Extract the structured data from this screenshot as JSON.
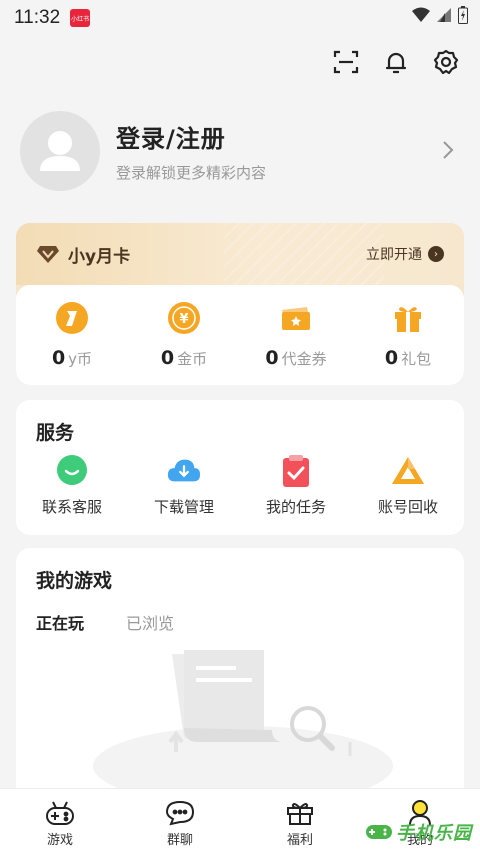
{
  "status_bar": {
    "time": "11:32",
    "notification_badge": "小红书"
  },
  "top_actions": [
    "scan-icon",
    "bell-icon",
    "gear-icon"
  ],
  "profile": {
    "title": "登录/注册",
    "subtitle": "登录解锁更多精彩内容"
  },
  "vip_card": {
    "title": "小y月卡",
    "action": "立即开通"
  },
  "assets": [
    {
      "value": "0",
      "unit": "y币",
      "icon": "y-coin-icon",
      "color": "#f5a623"
    },
    {
      "value": "0",
      "unit": "金币",
      "icon": "gold-coin-icon",
      "color": "#f5a623"
    },
    {
      "value": "0",
      "unit": "代金券",
      "icon": "voucher-icon",
      "color": "#f5a623"
    },
    {
      "value": "0",
      "unit": "礼包",
      "icon": "gift-icon",
      "color": "#f5a623"
    }
  ],
  "services": {
    "title": "服务",
    "items": [
      {
        "label": "联系客服",
        "icon": "chat-support-icon",
        "color": "#3ecb7a"
      },
      {
        "label": "下载管理",
        "icon": "cloud-download-icon",
        "color": "#41a5f0"
      },
      {
        "label": "我的任务",
        "icon": "task-clipboard-icon",
        "color": "#f2515a"
      },
      {
        "label": "账号回收",
        "icon": "recycle-triangle-icon",
        "color": "#f5a623"
      }
    ]
  },
  "my_games": {
    "title": "我的游戏",
    "tabs": [
      "正在玩",
      "已浏览"
    ],
    "active_tab": 0
  },
  "bottom_nav": [
    {
      "label": "游戏",
      "icon": "gamepad-icon"
    },
    {
      "label": "群聊",
      "icon": "group-chat-icon"
    },
    {
      "label": "福利",
      "icon": "gift-box-icon"
    },
    {
      "label": "我的",
      "icon": "profile-icon"
    }
  ],
  "watermark": {
    "text": "手机乐园"
  }
}
